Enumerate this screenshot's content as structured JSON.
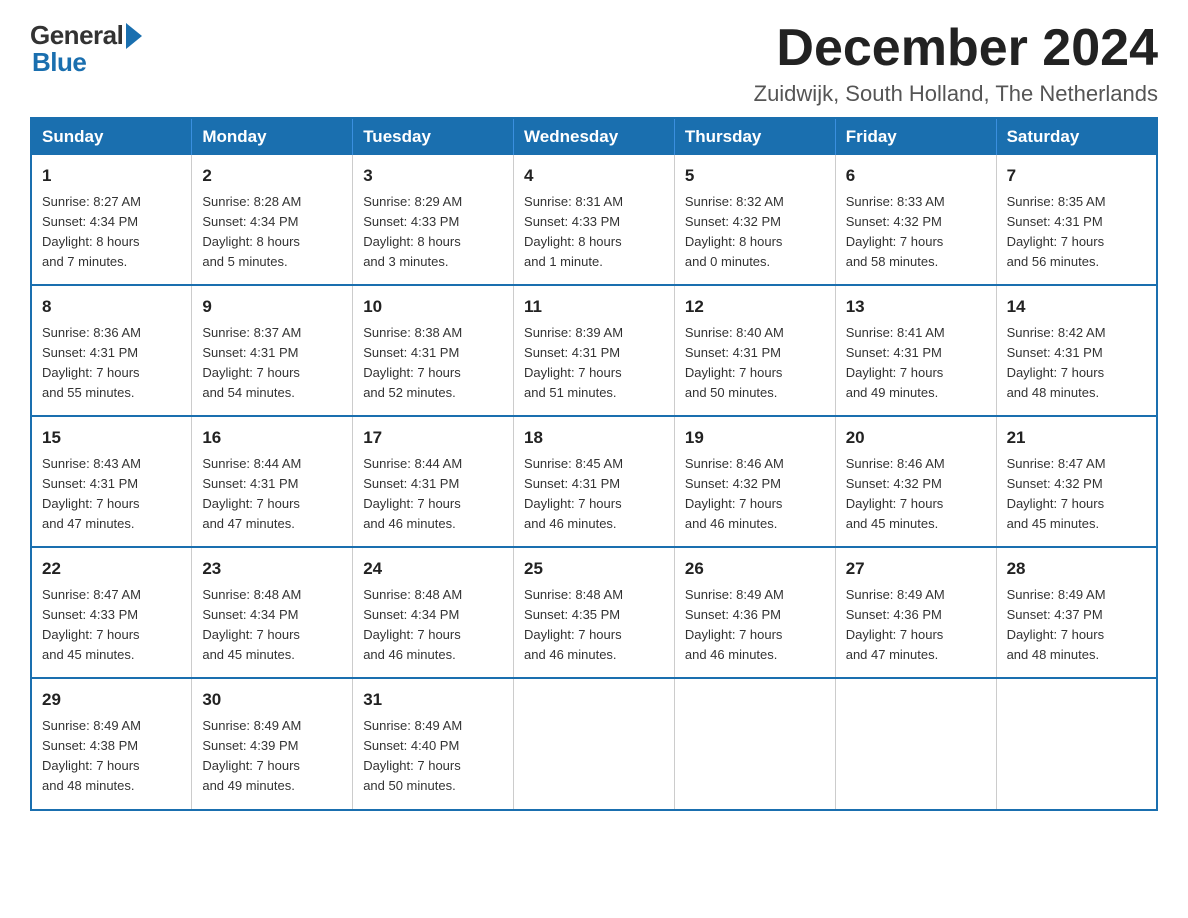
{
  "header": {
    "logo_general": "General",
    "logo_blue": "Blue",
    "month_title": "December 2024",
    "location": "Zuidwijk, South Holland, The Netherlands"
  },
  "calendar": {
    "days_of_week": [
      "Sunday",
      "Monday",
      "Tuesday",
      "Wednesday",
      "Thursday",
      "Friday",
      "Saturday"
    ],
    "weeks": [
      [
        {
          "day": "1",
          "info": "Sunrise: 8:27 AM\nSunset: 4:34 PM\nDaylight: 8 hours\nand 7 minutes."
        },
        {
          "day": "2",
          "info": "Sunrise: 8:28 AM\nSunset: 4:34 PM\nDaylight: 8 hours\nand 5 minutes."
        },
        {
          "day": "3",
          "info": "Sunrise: 8:29 AM\nSunset: 4:33 PM\nDaylight: 8 hours\nand 3 minutes."
        },
        {
          "day": "4",
          "info": "Sunrise: 8:31 AM\nSunset: 4:33 PM\nDaylight: 8 hours\nand 1 minute."
        },
        {
          "day": "5",
          "info": "Sunrise: 8:32 AM\nSunset: 4:32 PM\nDaylight: 8 hours\nand 0 minutes."
        },
        {
          "day": "6",
          "info": "Sunrise: 8:33 AM\nSunset: 4:32 PM\nDaylight: 7 hours\nand 58 minutes."
        },
        {
          "day": "7",
          "info": "Sunrise: 8:35 AM\nSunset: 4:31 PM\nDaylight: 7 hours\nand 56 minutes."
        }
      ],
      [
        {
          "day": "8",
          "info": "Sunrise: 8:36 AM\nSunset: 4:31 PM\nDaylight: 7 hours\nand 55 minutes."
        },
        {
          "day": "9",
          "info": "Sunrise: 8:37 AM\nSunset: 4:31 PM\nDaylight: 7 hours\nand 54 minutes."
        },
        {
          "day": "10",
          "info": "Sunrise: 8:38 AM\nSunset: 4:31 PM\nDaylight: 7 hours\nand 52 minutes."
        },
        {
          "day": "11",
          "info": "Sunrise: 8:39 AM\nSunset: 4:31 PM\nDaylight: 7 hours\nand 51 minutes."
        },
        {
          "day": "12",
          "info": "Sunrise: 8:40 AM\nSunset: 4:31 PM\nDaylight: 7 hours\nand 50 minutes."
        },
        {
          "day": "13",
          "info": "Sunrise: 8:41 AM\nSunset: 4:31 PM\nDaylight: 7 hours\nand 49 minutes."
        },
        {
          "day": "14",
          "info": "Sunrise: 8:42 AM\nSunset: 4:31 PM\nDaylight: 7 hours\nand 48 minutes."
        }
      ],
      [
        {
          "day": "15",
          "info": "Sunrise: 8:43 AM\nSunset: 4:31 PM\nDaylight: 7 hours\nand 47 minutes."
        },
        {
          "day": "16",
          "info": "Sunrise: 8:44 AM\nSunset: 4:31 PM\nDaylight: 7 hours\nand 47 minutes."
        },
        {
          "day": "17",
          "info": "Sunrise: 8:44 AM\nSunset: 4:31 PM\nDaylight: 7 hours\nand 46 minutes."
        },
        {
          "day": "18",
          "info": "Sunrise: 8:45 AM\nSunset: 4:31 PM\nDaylight: 7 hours\nand 46 minutes."
        },
        {
          "day": "19",
          "info": "Sunrise: 8:46 AM\nSunset: 4:32 PM\nDaylight: 7 hours\nand 46 minutes."
        },
        {
          "day": "20",
          "info": "Sunrise: 8:46 AM\nSunset: 4:32 PM\nDaylight: 7 hours\nand 45 minutes."
        },
        {
          "day": "21",
          "info": "Sunrise: 8:47 AM\nSunset: 4:32 PM\nDaylight: 7 hours\nand 45 minutes."
        }
      ],
      [
        {
          "day": "22",
          "info": "Sunrise: 8:47 AM\nSunset: 4:33 PM\nDaylight: 7 hours\nand 45 minutes."
        },
        {
          "day": "23",
          "info": "Sunrise: 8:48 AM\nSunset: 4:34 PM\nDaylight: 7 hours\nand 45 minutes."
        },
        {
          "day": "24",
          "info": "Sunrise: 8:48 AM\nSunset: 4:34 PM\nDaylight: 7 hours\nand 46 minutes."
        },
        {
          "day": "25",
          "info": "Sunrise: 8:48 AM\nSunset: 4:35 PM\nDaylight: 7 hours\nand 46 minutes."
        },
        {
          "day": "26",
          "info": "Sunrise: 8:49 AM\nSunset: 4:36 PM\nDaylight: 7 hours\nand 46 minutes."
        },
        {
          "day": "27",
          "info": "Sunrise: 8:49 AM\nSunset: 4:36 PM\nDaylight: 7 hours\nand 47 minutes."
        },
        {
          "day": "28",
          "info": "Sunrise: 8:49 AM\nSunset: 4:37 PM\nDaylight: 7 hours\nand 48 minutes."
        }
      ],
      [
        {
          "day": "29",
          "info": "Sunrise: 8:49 AM\nSunset: 4:38 PM\nDaylight: 7 hours\nand 48 minutes."
        },
        {
          "day": "30",
          "info": "Sunrise: 8:49 AM\nSunset: 4:39 PM\nDaylight: 7 hours\nand 49 minutes."
        },
        {
          "day": "31",
          "info": "Sunrise: 8:49 AM\nSunset: 4:40 PM\nDaylight: 7 hours\nand 50 minutes."
        },
        {
          "day": "",
          "info": ""
        },
        {
          "day": "",
          "info": ""
        },
        {
          "day": "",
          "info": ""
        },
        {
          "day": "",
          "info": ""
        }
      ]
    ]
  }
}
